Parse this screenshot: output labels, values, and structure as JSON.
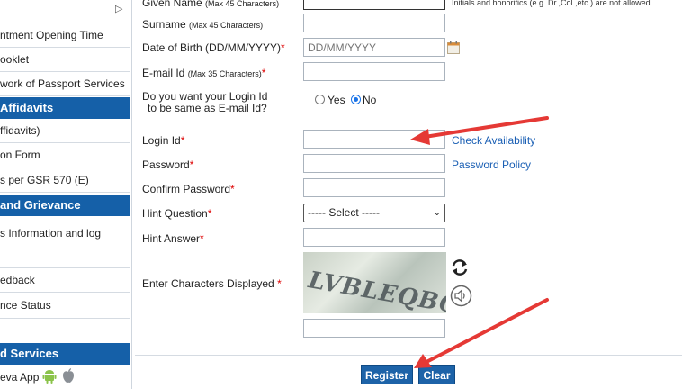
{
  "sidebar": {
    "items": [
      {
        "label": "ntment Opening Time"
      },
      {
        "label": "ooklet"
      },
      {
        "label": "work of Passport Services"
      },
      {
        "label": "ffidavits)"
      },
      {
        "label": "on Form"
      },
      {
        "label": "s per GSR 570 (E)"
      },
      {
        "label": "s Information and log"
      },
      {
        "label": "edback"
      },
      {
        "label": "nce Status"
      },
      {
        "label": "eva App"
      }
    ],
    "headers": [
      {
        "label": "Affidavits"
      },
      {
        "label": "and Grievance"
      },
      {
        "label": "d Services"
      }
    ]
  },
  "form": {
    "given_name_label": "Given Name",
    "given_name_hint": "(Max 45 Characters)",
    "given_name_note": "Initials and honorifics (e.g. Dr.,Col.,etc.) are not allowed.",
    "surname_label": "Surname",
    "surname_hint": "(Max 45 Characters)",
    "dob_label": "Date of Birth (DD/MM/YYYY)",
    "dob_placeholder": "DD/MM/YYYY",
    "email_label": "E-mail Id",
    "email_hint": "(Max 35 Characters)",
    "same_login_q1": "Do you want your Login Id",
    "same_login_q2": "to be same as E-mail Id?",
    "yes_label": "Yes",
    "no_label": "No",
    "login_label": "Login Id",
    "check_availability": "Check Availability",
    "password_label": "Password",
    "password_policy": "Password Policy",
    "confirm_label": "Confirm Password",
    "hint_q_label": "Hint Question",
    "hint_q_selected": "----- Select -----",
    "hint_a_label": "Hint Answer",
    "captcha_label": "Enter Characters Displayed",
    "captcha_text": "LVBLEQBQ",
    "required_mark": "*",
    "register": "Register",
    "clear": "Clear"
  },
  "colors": {
    "accent": "#1560a8",
    "arrow": "#e53935",
    "link": "#1a5fb4",
    "required": "#dd0000"
  },
  "icons": [
    "triangle-right-icon",
    "refresh-icon",
    "speaker-icon",
    "android-icon",
    "apple-icon",
    "calendar-icon"
  ]
}
